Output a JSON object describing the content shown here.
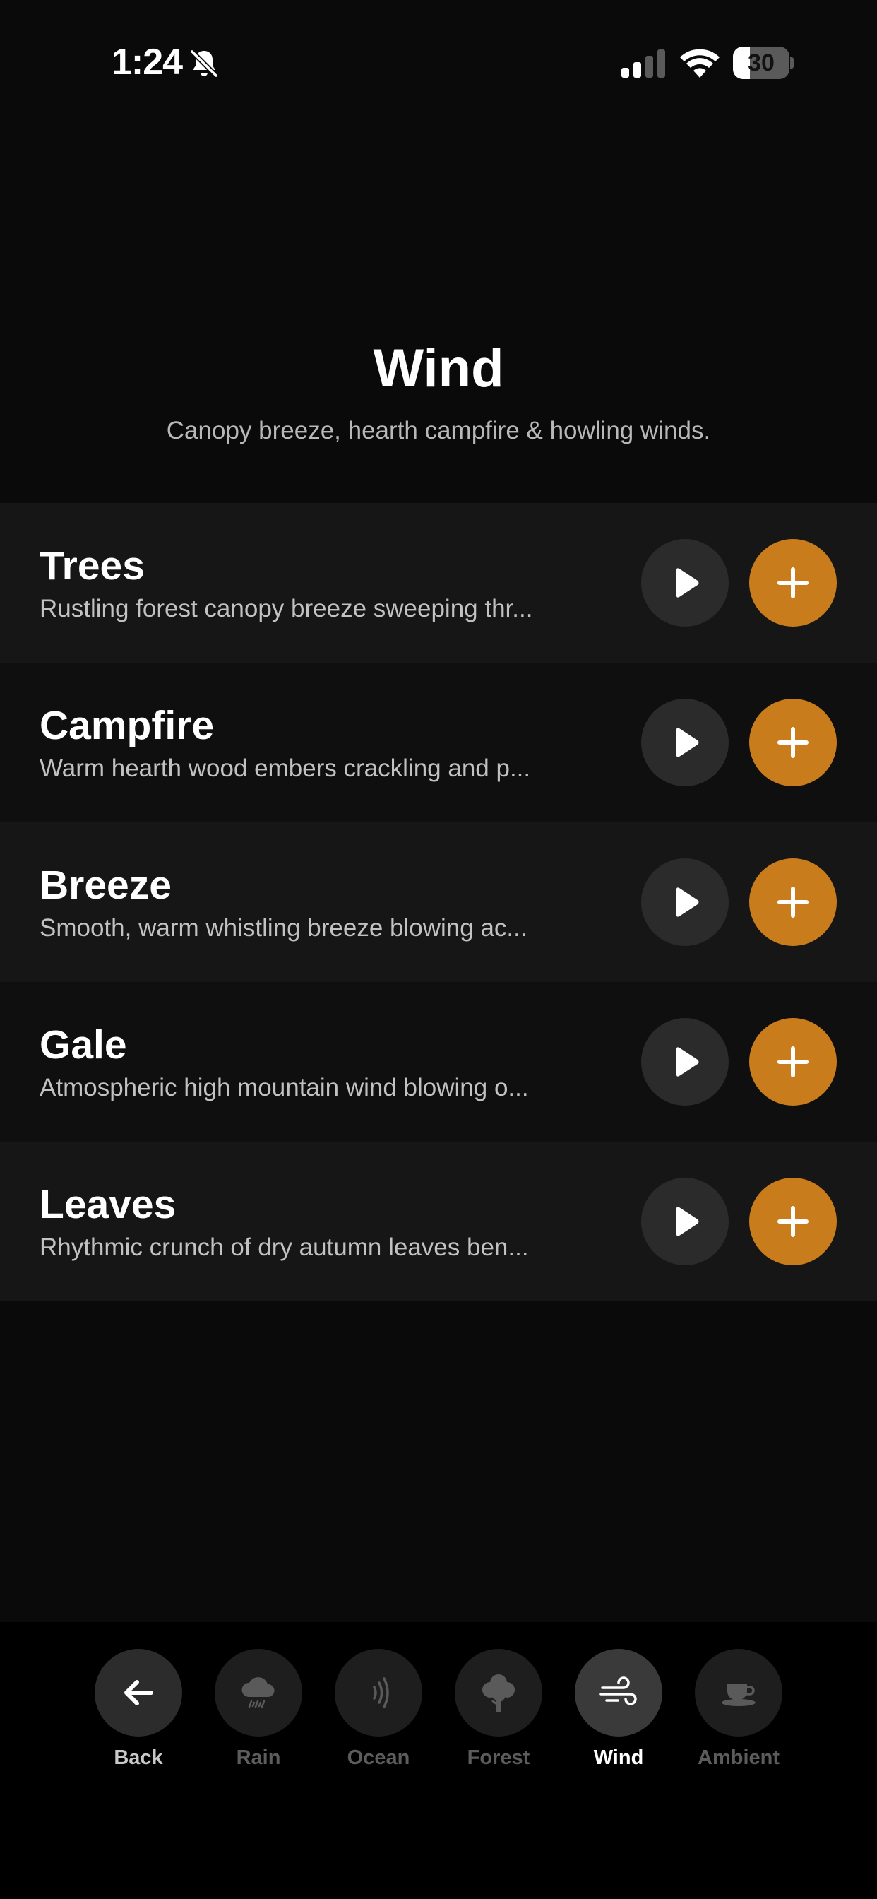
{
  "status_bar": {
    "time": "1:24",
    "battery_percent": 30,
    "battery_text": "30",
    "icons": [
      "bell-slash-icon",
      "signal-icon",
      "wifi-icon",
      "battery-icon"
    ]
  },
  "header": {
    "title": "Wind",
    "subtitle": "Canopy breeze, hearth campfire & howling winds."
  },
  "sounds": [
    {
      "title": "Trees",
      "description": "Rustling forest canopy breeze sweeping thr..."
    },
    {
      "title": "Campfire",
      "description": "Warm hearth wood embers crackling and p..."
    },
    {
      "title": "Breeze",
      "description": "Smooth, warm whistling breeze blowing ac..."
    },
    {
      "title": "Gale",
      "description": "Atmospheric high mountain wind blowing o..."
    },
    {
      "title": "Leaves",
      "description": "Rhythmic crunch of dry autumn leaves ben..."
    }
  ],
  "row_actions": {
    "play_icon": "play-icon",
    "add_icon": "plus-icon"
  },
  "tabs": [
    {
      "label": "Back",
      "icon": "arrow-left-icon"
    },
    {
      "label": "Rain",
      "icon": "rain-cloud-icon"
    },
    {
      "label": "Ocean",
      "icon": "sound-waves-icon"
    },
    {
      "label": "Forest",
      "icon": "tree-icon"
    },
    {
      "label": "Wind",
      "icon": "wind-icon",
      "selected": true
    },
    {
      "label": "Ambient",
      "icon": "coffee-cup-icon"
    }
  ],
  "colors": {
    "background": "#0a0a0a",
    "accent": "#c97c1c",
    "row_alt_a": "#161616",
    "row_alt_b": "#0f0f0f"
  }
}
